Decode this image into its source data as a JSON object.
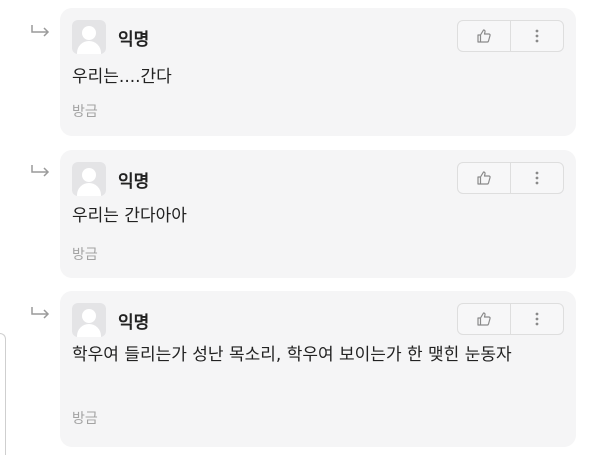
{
  "comments": [
    {
      "author": "익명",
      "text": "우리는....간다",
      "time": "방금",
      "like_icon": "thumbs-up-icon",
      "more_icon": "more-vertical-icon"
    },
    {
      "author": "익명",
      "text": "우리는 간다아아",
      "time": "방금",
      "like_icon": "thumbs-up-icon",
      "more_icon": "more-vertical-icon"
    },
    {
      "author": "익명",
      "text": "학우여 들리는가 성난 목소리, 학우여 보이는가 한 맺힌 눈동자",
      "time": "방금",
      "like_icon": "thumbs-up-icon",
      "more_icon": "more-vertical-icon"
    }
  ],
  "colors": {
    "card_background": "#f5f5f6",
    "text": "#222222",
    "muted_text": "#a3a3a3",
    "icon": "#8a8a8a"
  }
}
